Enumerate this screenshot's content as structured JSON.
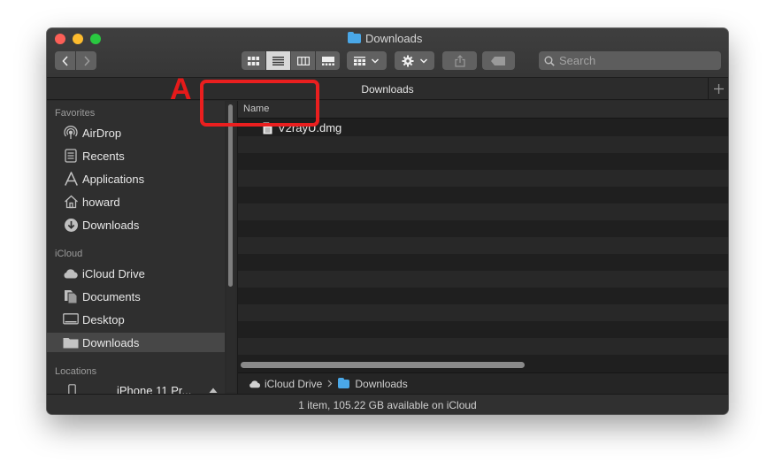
{
  "window": {
    "title": "Downloads"
  },
  "toolbar": {
    "back_icon": "chevron-left-icon",
    "forward_icon": "chevron-right-icon",
    "search_placeholder": "Search"
  },
  "tab": {
    "label": "Downloads"
  },
  "sidebar": {
    "favorites_header": "Favorites",
    "favorites": [
      {
        "label": "AirDrop",
        "icon": "airdrop-icon"
      },
      {
        "label": "Recents",
        "icon": "recents-icon"
      },
      {
        "label": "Applications",
        "icon": "applications-icon"
      },
      {
        "label": "howard",
        "icon": "home-icon"
      },
      {
        "label": "Downloads",
        "icon": "downloads-icon"
      }
    ],
    "icloud_header": "iCloud",
    "icloud": [
      {
        "label": "iCloud Drive",
        "icon": "cloud-icon"
      },
      {
        "label": "Documents",
        "icon": "documents-icon"
      },
      {
        "label": "Desktop",
        "icon": "desktop-icon"
      },
      {
        "label": "Downloads",
        "icon": "folder-icon",
        "selected": true
      }
    ],
    "locations_header": "Locations",
    "locations": [
      {
        "label": "iPhone 11 Pr...",
        "icon": "phone-icon"
      }
    ]
  },
  "list": {
    "column_name": "Name",
    "files": [
      {
        "name": "V2rayU.dmg",
        "icon": "document-icon"
      }
    ]
  },
  "pathbar": {
    "items": [
      "iCloud Drive",
      "Downloads"
    ]
  },
  "status": {
    "text": "1 item, 105.22 GB available on iCloud"
  },
  "annotation": {
    "label": "A",
    "color": "#ea1f1f"
  },
  "colors": {
    "folder_blue": "#4aa8e8",
    "close": "#fc5f57",
    "minimize": "#fdbc2e",
    "maximize": "#29c840"
  }
}
